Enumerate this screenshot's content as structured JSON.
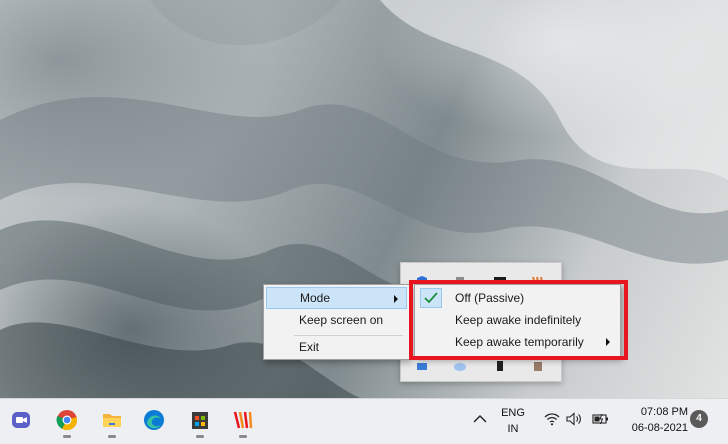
{
  "context_menu": {
    "items": [
      {
        "label": "Mode"
      },
      {
        "label": "Keep screen on"
      },
      {
        "label": "Exit"
      }
    ]
  },
  "mode_submenu": {
    "items": [
      {
        "label": "Off (Passive)",
        "checked": true
      },
      {
        "label": "Keep awake indefinitely"
      },
      {
        "label": "Keep awake temporarily"
      }
    ]
  },
  "taskbar": {
    "apps": [
      {
        "name": "Teams",
        "icon": "teams-icon"
      },
      {
        "name": "Chrome",
        "icon": "chrome-icon"
      },
      {
        "name": "File Explorer",
        "icon": "folder-icon"
      },
      {
        "name": "Edge",
        "icon": "edge-icon"
      },
      {
        "name": "Microsoft Store",
        "icon": "store-icon"
      },
      {
        "name": "App",
        "icon": "app-icon"
      }
    ],
    "language": {
      "line1": "ENG",
      "line2": "IN"
    },
    "clock": {
      "time": "07:08 PM",
      "date": "06-08-2021"
    },
    "notification_count": "4"
  },
  "colors": {
    "highlight_frame": "#e8141e",
    "menu_highlight": "#cce4f7",
    "checkmark": "#1e8e3e"
  }
}
